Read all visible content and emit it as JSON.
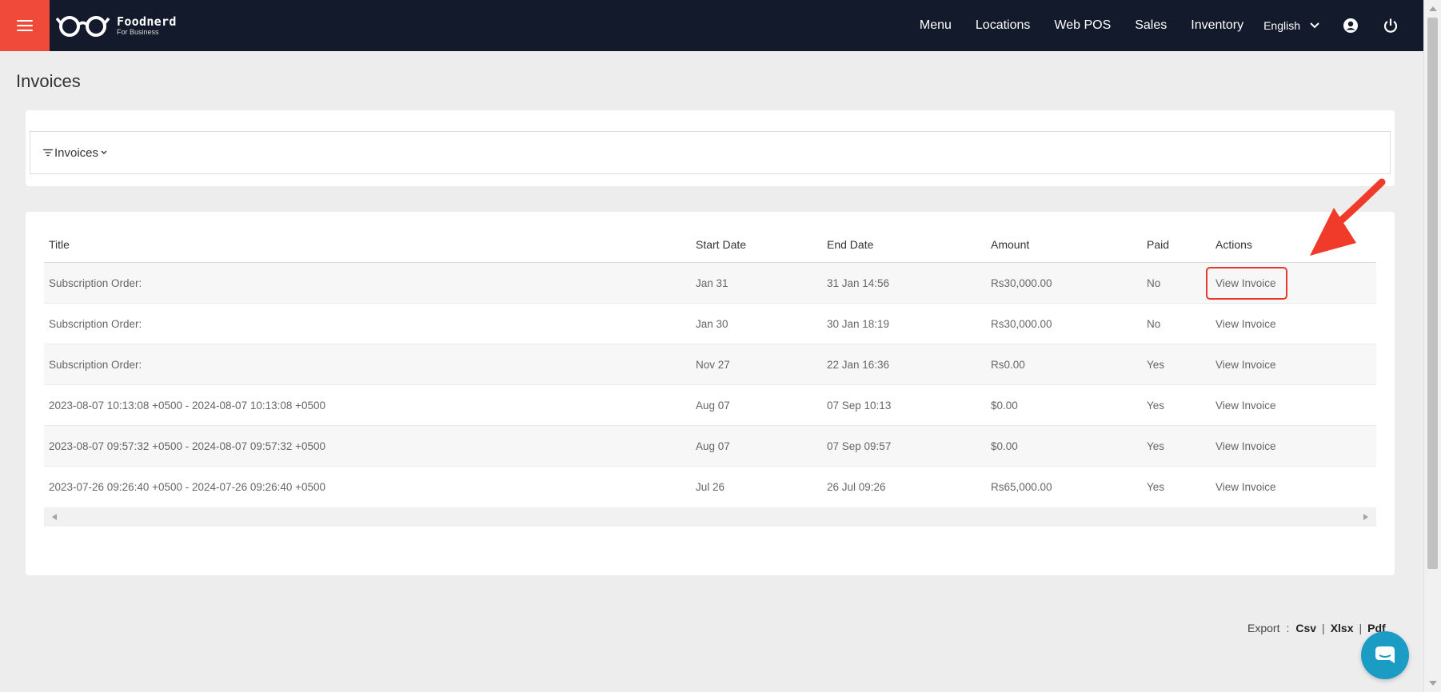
{
  "header": {
    "brand_name": "Foodnerd",
    "brand_sub": "For Business",
    "nav": [
      {
        "label": "Menu"
      },
      {
        "label": "Locations"
      },
      {
        "label": "Web POS"
      },
      {
        "label": "Sales"
      },
      {
        "label": "Inventory"
      }
    ],
    "language": "English",
    "icons": [
      "hamburger-menu-icon",
      "glasses-logo-icon",
      "chevron-down-icon",
      "user-account-icon",
      "power-icon"
    ]
  },
  "page": {
    "title": "Invoices"
  },
  "filter": {
    "label": "Invoices",
    "icon": "filter-icon"
  },
  "table": {
    "columns": {
      "title": "Title",
      "start": "Start Date",
      "end": "End Date",
      "amount": "Amount",
      "paid": "Paid",
      "actions": "Actions"
    },
    "rows": [
      {
        "title": "Subscription Order:",
        "start": "Jan 31",
        "end": "31 Jan 14:56",
        "amount": "Rs30,000.00",
        "paid": "No",
        "action": "View Invoice"
      },
      {
        "title": "Subscription Order:",
        "start": "Jan 30",
        "end": "30 Jan 18:19",
        "amount": "Rs30,000.00",
        "paid": "No",
        "action": "View Invoice"
      },
      {
        "title": "Subscription Order:",
        "start": "Nov 27",
        "end": "22 Jan 16:36",
        "amount": "Rs0.00",
        "paid": "Yes",
        "action": "View Invoice"
      },
      {
        "title": "2023-08-07 10:13:08 +0500 - 2024-08-07 10:13:08 +0500",
        "start": "Aug 07",
        "end": "07 Sep 10:13",
        "amount": "$0.00",
        "paid": "Yes",
        "action": "View Invoice"
      },
      {
        "title": "2023-08-07 09:57:32 +0500 - 2024-08-07 09:57:32 +0500",
        "start": "Aug 07",
        "end": "07 Sep 09:57",
        "amount": "$0.00",
        "paid": "Yes",
        "action": "View Invoice"
      },
      {
        "title": "2023-07-26 09:26:40 +0500 - 2024-07-26 09:26:40 +0500",
        "start": "Jul 26",
        "end": "26 Jul 09:26",
        "amount": "Rs65,000.00",
        "paid": "Yes",
        "action": "View Invoice"
      }
    ]
  },
  "export": {
    "label": "Export",
    "colon": ":",
    "csv": "Csv",
    "xlsx": "Xlsx",
    "pdf": "Pdf",
    "separator": "|"
  },
  "colors": {
    "topbar": "#121a2b",
    "accent": "#f04b3a",
    "highlight": "#e8382b",
    "chat": "#1b9cc4"
  }
}
